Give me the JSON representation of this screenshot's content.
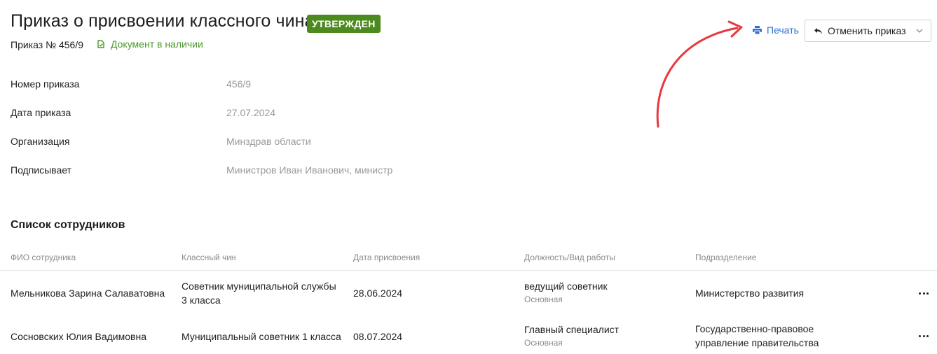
{
  "header": {
    "title": "Приказ о присвоении классного чина",
    "status_badge": "УТВЕРЖДЕН",
    "order_number": "Приказ № 456/9",
    "document_status": "Документ в наличии",
    "print_label": "Печать",
    "cancel_label": "Отменить приказ",
    "colors": {
      "badge": "#4d8a1e",
      "link": "#2f6fd6",
      "doc_status": "#4a9a2a",
      "annotation_arrow": "#e8383d"
    }
  },
  "fields": [
    {
      "label": "Номер приказа",
      "value": "456/9"
    },
    {
      "label": "Дата приказа",
      "value": "27.07.2024"
    },
    {
      "label": "Организация",
      "value": "Минздрав области"
    },
    {
      "label": "Подписывает",
      "value": "Министров Иван Иванович, министр"
    }
  ],
  "employees": {
    "title": "Список сотрудников",
    "columns": [
      "ФИО сотрудника",
      "Классный чин",
      "Дата присвоения",
      "Должность/Вид работы",
      "Подразделение"
    ],
    "rows": [
      {
        "name": "Мельникова Зарина Салаватовна",
        "rank_line1": "Советник муниципальной службы",
        "rank_line2": "3 класса",
        "date": "28.06.2024",
        "position": "ведущий советник",
        "work_type": "Основная",
        "division_line1": "Министерство развития",
        "division_line2": ""
      },
      {
        "name": "Сосновских Юлия Вадимовна",
        "rank_line1": "Муниципальный советник 1 класса",
        "rank_line2": "",
        "date": "08.07.2024",
        "position": "Главный специалист",
        "work_type": "Основная",
        "division_line1": "Государственно-правовое",
        "division_line2": "управление правительства"
      }
    ]
  },
  "icons": {
    "document_status": "document-check-icon",
    "print": "printer-icon",
    "cancel": "undo-icon",
    "dropdown": "chevron-down-icon",
    "row_menu": "more-horizontal-icon"
  }
}
